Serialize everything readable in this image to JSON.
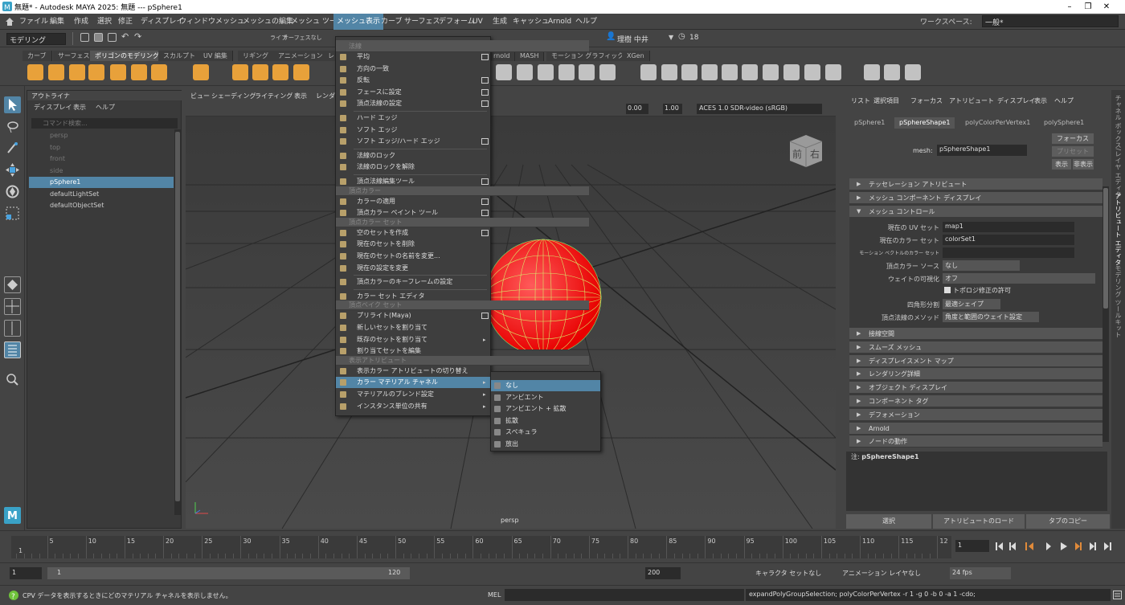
{
  "window": {
    "title": "無題* - Autodesk MAYA 2025: 無題   ---   pSphere1",
    "minimize": "–",
    "maximize": "❐",
    "close": "✕"
  },
  "menubar": {
    "items": [
      "ファイル",
      "編集",
      "作成",
      "選択",
      "修正",
      "ディスプレイ",
      "ウィンドウ",
      "メッシュ",
      "メッシュの編集",
      "メッシュ ツール",
      "メッシュ表示",
      "カーブ",
      "サーフェス",
      "デフォーム",
      "UV",
      "生成",
      "キャッシュ",
      "Arnold",
      "ヘルプ"
    ],
    "active": "メッシュ表示",
    "workspace_label": "ワークスペース:",
    "workspace_value": "一般*"
  },
  "statusline": {
    "mode": "モデリング",
    "live_label": "ライブ",
    "live_value": "サーフェスなし",
    "user": "理樹 中井",
    "credits": "18"
  },
  "shelf": {
    "tabs": [
      "カーブ",
      "サーフェス",
      "ポリゴンのモデリング",
      "スカルプト",
      "UV 編集",
      "リギング",
      "アニメーション",
      "レ",
      "rnold",
      "MASH",
      "モーション グラフィックス",
      "XGen"
    ],
    "active": "ポリゴンのモデリング"
  },
  "outliner": {
    "title": "アウトライナ",
    "menu": [
      "ディスプレイ",
      "表示",
      "ヘルプ"
    ],
    "search_placeholder": "コマンド検索...",
    "items": [
      {
        "label": "persp",
        "dim": true
      },
      {
        "label": "top",
        "dim": true
      },
      {
        "label": "front",
        "dim": true
      },
      {
        "label": "side",
        "dim": true
      },
      {
        "label": "pSphere1",
        "selected": true
      },
      {
        "label": "defaultLightSet"
      },
      {
        "label": "defaultObjectSet"
      }
    ]
  },
  "viewport": {
    "menu": [
      "ビュー",
      "シェーディング",
      "ライティング",
      "表示",
      "レンダ"
    ],
    "exposure": "0.00",
    "gamma": "1.00",
    "colorspace": "ACES 1.0 SDR-video (sRGB)",
    "camera": "persp",
    "viewcube": {
      "front": "前",
      "right": "右"
    }
  },
  "mesh_display_menu": {
    "title": "法線",
    "rows": [
      {
        "label": "平均",
        "box": true
      },
      {
        "label": "方向の一致"
      },
      {
        "label": "反転",
        "box": true
      },
      {
        "label": "フェースに設定",
        "box": true
      },
      {
        "label": "頂点法線の設定",
        "box": true
      },
      {
        "divider": true
      },
      {
        "label": "ハード エッジ"
      },
      {
        "label": "ソフト エッジ"
      },
      {
        "label": "ソフト エッジ/ハード エッジ",
        "box": true
      },
      {
        "divider": true
      },
      {
        "label": "法線のロック"
      },
      {
        "label": "法線のロックを解除"
      },
      {
        "divider": true
      },
      {
        "label": "頂点法線編集ツール",
        "box": true
      },
      {
        "section": "頂点カラー"
      },
      {
        "label": "カラーの適用",
        "box": true
      },
      {
        "label": "頂点カラー ペイント ツール",
        "box": true
      },
      {
        "section": "頂点カラー セット"
      },
      {
        "label": "空のセットを作成",
        "box": true
      },
      {
        "label": "現在のセットを削除"
      },
      {
        "label": "現在のセットの名前を変更..."
      },
      {
        "label": "現在の設定を変更"
      },
      {
        "divider": true
      },
      {
        "label": "頂点カラーのキーフレームの設定"
      },
      {
        "divider": true
      },
      {
        "label": "カラー セット エディタ"
      },
      {
        "section": "頂点ベイク セット"
      },
      {
        "label": "プリライト(Maya)",
        "box": true
      },
      {
        "label": "新しいセットを割り当て"
      },
      {
        "label": "既存のセットを割り当て",
        "arrow": true
      },
      {
        "label": "割り当てセットを編集"
      },
      {
        "section": "表示アトリビュート"
      },
      {
        "label": "表示カラー アトリビュートの切り替え"
      },
      {
        "label": "カラー マテリアル チャネル",
        "arrow": true,
        "highlight": true
      },
      {
        "label": "マテリアルのブレンド設定",
        "arrow": true
      },
      {
        "label": "インスタンス単位の共有",
        "arrow": true
      }
    ]
  },
  "submenu": {
    "items": [
      "なし",
      "アンビエント",
      "アンビエント + 拡散",
      "拡散",
      "スペキュラ",
      "放出"
    ],
    "highlight": "なし"
  },
  "attribute_editor": {
    "menu": [
      "リスト",
      "選択項目",
      "フォーカス",
      "アトリビュート",
      "ディスプレイ",
      "表示",
      "ヘルプ"
    ],
    "tabs": [
      "pSphere1",
      "pSphereShape1",
      "polyColorPerVertex1",
      "polySphere1"
    ],
    "active_tab": "pSphereShape1",
    "mesh_label": "mesh:",
    "mesh_value": "pSphereShape1",
    "focus_btn": "フォーカス",
    "preset_btn": "プリセット",
    "show_btn": "表示",
    "hide_btn": "非表示",
    "sections_top": [
      "テッセレーション アトリビュート",
      "メッシュ コンポーネント ディスプレイ",
      "メッシュ コントロール"
    ],
    "fields": {
      "current_uv_label": "現在の UV セット",
      "current_uv": "map1",
      "current_color_label": "現在のカラー セット",
      "current_color": "colorSet1",
      "motion_label": "モーション ベクトルのカラー セット",
      "motion": "",
      "vcolor_source_label": "頂点カラー ソース",
      "vcolor_source": "なし",
      "weight_vis_label": "ウェイトの可視化",
      "weight_vis": "オフ",
      "topo_check": "トポロジ修正の許可",
      "quad_label": "四角形分割",
      "quad": "最適シェイプ",
      "vnormal_label": "頂点法線のメソッド",
      "vnormal": "角度と範囲のウェイト設定"
    },
    "sections_bottom": [
      "接線空間",
      "スムーズ メッシュ",
      "ディスプレイスメント マップ",
      "レンダリング詳細",
      "オブジェクト ディスプレイ",
      "コンポーネント タグ",
      "デフォメーション",
      "Arnold",
      "ノードの動作"
    ],
    "notes_label": "注:",
    "notes_value": "pSphereShape1",
    "footer": [
      "選択",
      "アトリビュートのロード",
      "タブのコピー"
    ]
  },
  "right_strip": [
    "チャネル ボックス/レイヤ エディタ",
    "アトリビュート エディタ",
    "モデリング ツールキット"
  ],
  "timeline": {
    "ticks": [
      "1",
      "5",
      "10",
      "15",
      "20",
      "25",
      "30",
      "35",
      "40",
      "45",
      "50",
      "55",
      "60",
      "65",
      "70",
      "75",
      "80",
      "85",
      "90",
      "95",
      "100",
      "105",
      "110",
      "115",
      "12"
    ],
    "current": "1"
  },
  "range": {
    "start": "1",
    "inner_start": "1",
    "inner_end": "120",
    "end": "200",
    "charset": "キャラクタ セットなし",
    "animlayer": "アニメーション レイヤなし",
    "fps": "24 fps"
  },
  "helpline": {
    "help": "CPV データを表示するときにどのマテリアル チャネルを表示しません。",
    "mel_label": "MEL",
    "command_output": "expandPolyGroupSelection; polyColorPerVertex -r 1 -g 0 -b 0 -a 1 -cdo;"
  },
  "colors": {
    "accent": "#5285a6",
    "sphere": "#ff1a1a",
    "wire": "#7fff70"
  }
}
